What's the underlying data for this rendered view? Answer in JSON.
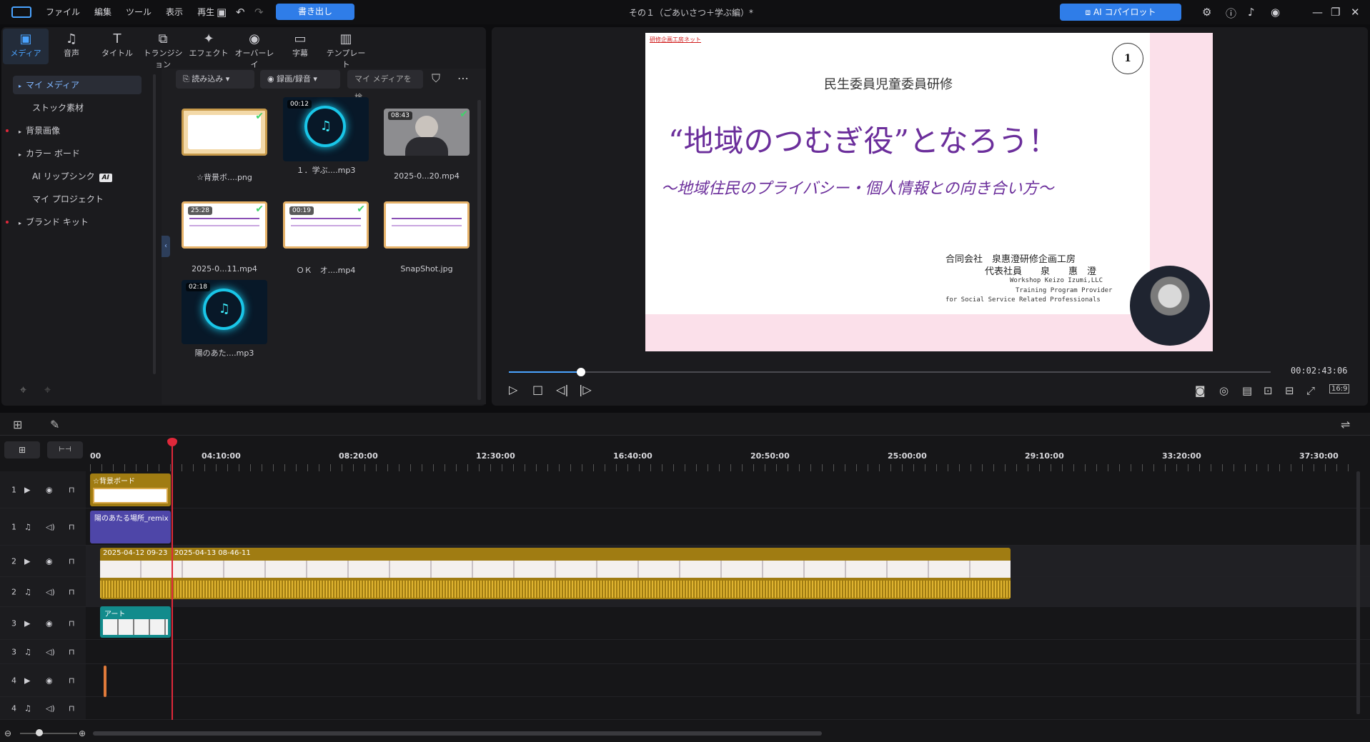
{
  "titlebar": {
    "menu": [
      "ファイル",
      "編集",
      "ツール",
      "表示",
      "再生"
    ],
    "export": "書き出し",
    "doc_title": "その１（ごあいさつ＋学ぶ編）*",
    "ai_copilot": "AI コパイロット"
  },
  "tabs": [
    {
      "label": "メディア",
      "icon": "▣"
    },
    {
      "label": "音声",
      "icon": "♫"
    },
    {
      "label": "タイトル",
      "icon": "T"
    },
    {
      "label": "トランジション",
      "icon": "⧉"
    },
    {
      "label": "エフェクト",
      "icon": "✦"
    },
    {
      "label": "オーバーレイ",
      "icon": "◉"
    },
    {
      "label": "字幕",
      "icon": "▭"
    },
    {
      "label": "テンプレート",
      "icon": "▥"
    }
  ],
  "sidebar": {
    "items": [
      "マイ メディア",
      "ストック素材",
      "背景画像",
      "カラー ボード",
      "AI リップシンク",
      "マイ プロジェクト",
      "ブランド キット"
    ],
    "ai_badge": "AI"
  },
  "media_toolbar": {
    "import": "読み込み",
    "record": "録画/録音",
    "search_placeholder": "マイ メディアを検"
  },
  "media": [
    {
      "caption": "☆背景ボ....png",
      "duration": "",
      "type": "board"
    },
    {
      "caption": "１．学ぶ....mp3",
      "duration": "00:12",
      "type": "ring"
    },
    {
      "caption": "2025-0...20.mp4",
      "duration": "08:43",
      "type": "person"
    },
    {
      "caption": "2025-0...11.mp4",
      "duration": "25:28",
      "type": "slide"
    },
    {
      "caption": "ＯＫ　オ....mp4",
      "duration": "00:19",
      "type": "slide2"
    },
    {
      "caption": "SnapShot.jpg",
      "duration": "",
      "type": "slide3"
    },
    {
      "caption": "陽のあた....mp3",
      "duration": "02:18",
      "type": "ring"
    }
  ],
  "preview": {
    "small_link": "研修企画工房ネット",
    "number": "1",
    "subtitle": "民生委員児童委員研修",
    "title": "“地域のつむぎ役”となろう！",
    "tagline": "〜地域住民のプライバシー・個人情報との向き合い方〜",
    "company": "合同会社　泉惠澄研修企画工房",
    "rep": "代表社員　　泉　　惠　澄",
    "en1": "Workshop Keizo Izumi,LLC",
    "en2": "Training Program Provider",
    "en3": "for Social Service Related Professionals",
    "timecode": "00:02:43:06",
    "aspect": "16:9",
    "progress": 0.095
  },
  "ruler": [
    "00",
    "04:10:00",
    "08:20:00",
    "12:30:00",
    "16:40:00",
    "20:50:00",
    "25:00:00",
    "29:10:00",
    "33:20:00",
    "37:30:00"
  ],
  "tracks": [
    {
      "num": "1",
      "kind": "video"
    },
    {
      "num": "1",
      "kind": "audio"
    },
    {
      "num": "2",
      "kind": "video"
    },
    {
      "num": "2",
      "kind": "audio"
    },
    {
      "num": "3",
      "kind": "video"
    },
    {
      "num": "3",
      "kind": "audio"
    },
    {
      "num": "4",
      "kind": "video"
    },
    {
      "num": "4",
      "kind": "audio"
    }
  ],
  "clips": {
    "bg_board": "☆背景ボード",
    "audio1": "陽のあたる場所_remix",
    "video_a": "2025-04-12 09-23",
    "video_b": "2025-04-13 08-46-11",
    "art": "アート"
  },
  "colors": {
    "accent": "#2f7de8",
    "clip_gold": "#a07c12",
    "clip_purple": "#4e46a8",
    "clip_teal": "#128b8c",
    "playhead": "#e0283a"
  }
}
